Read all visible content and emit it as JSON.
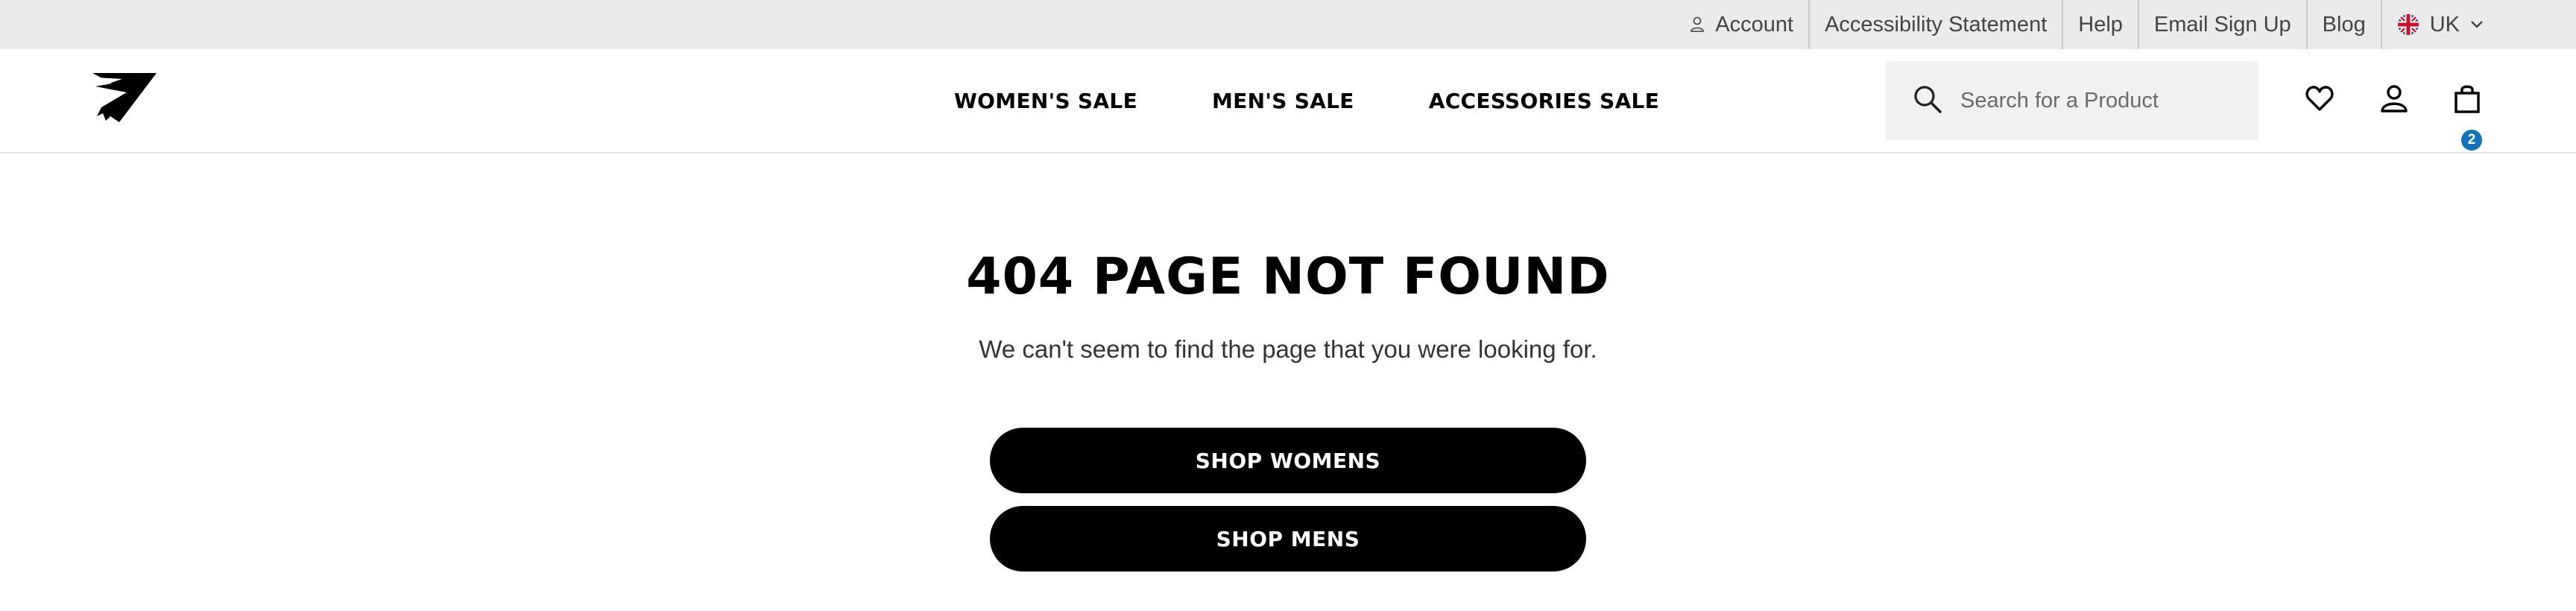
{
  "utility_bar": {
    "account": "Account",
    "accessibility": "Accessibility Statement",
    "help": "Help",
    "email_signup": "Email Sign Up",
    "blog": "Blog",
    "region": "UK"
  },
  "header": {
    "nav": [
      "WOMEN'S SALE",
      "MEN'S SALE",
      "ACCESSORIES SALE"
    ],
    "search_placeholder": "Search for a Product",
    "cart_count": "2",
    "icons": [
      "search-icon",
      "heart-icon",
      "user-icon",
      "bag-icon"
    ]
  },
  "main": {
    "title": "404 PAGE NOT FOUND",
    "message": "We can't seem to find the page that you were looking for.",
    "buttons": [
      "SHOP WOMENS",
      "SHOP MENS"
    ]
  },
  "colors": {
    "utility_bg": "#ebebeb",
    "badge": "#1473b8",
    "button_bg": "#000000",
    "button_text": "#ffffff"
  }
}
